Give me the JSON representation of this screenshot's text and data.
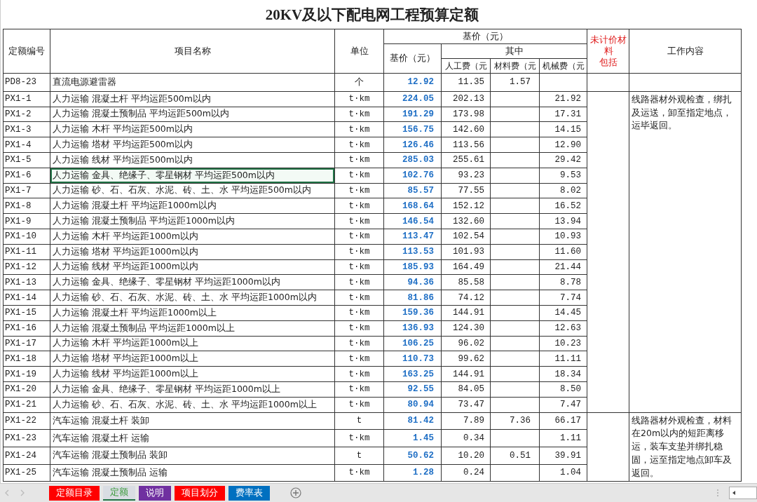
{
  "title": "20KV及以下配电网工程预算定额",
  "header": {
    "code": "定额编号",
    "name": "项目名称",
    "unit": "单位",
    "base_group": "基价（元）",
    "base": "基价（元）",
    "among": "其中",
    "labor": "人工费（元",
    "material": "材料费（元",
    "machine": "机械费（元",
    "unpriced": [
      "未计价材料",
      "包括"
    ],
    "work": "工作内容"
  },
  "groups": [
    {
      "rows": [
        {
          "code": "PD8-23",
          "name": "直流电源避雷器",
          "unit": "个",
          "base": "12.92",
          "labor": "11.35",
          "material": "1.57",
          "selected": false
        }
      ]
    },
    {
      "work_content": "线路器材外观检查，绑扎及运送，卸至指定地点，运毕返回。",
      "rows": [
        {
          "code": "PX1-1",
          "name": "人力运输 混凝土杆 平均运距500m以内",
          "unit": "t·km",
          "base": "224.05",
          "labor": "202.13",
          "machine": "21.92",
          "selected": false
        },
        {
          "code": "PX1-2",
          "name": "人力运输 混凝土预制品 平均运距500m以内",
          "unit": "t·km",
          "base": "191.29",
          "labor": "173.98",
          "machine": "17.31",
          "selected": false
        },
        {
          "code": "PX1-3",
          "name": "人力运输 木杆 平均运距500m以内",
          "unit": "t·km",
          "base": "156.75",
          "labor": "142.60",
          "machine": "14.15",
          "selected": false
        },
        {
          "code": "PX1-4",
          "name": "人力运输 塔材 平均运距500m以内",
          "unit": "t·km",
          "base": "126.46",
          "labor": "113.56",
          "machine": "12.90",
          "selected": false
        },
        {
          "code": "PX1-5",
          "name": "人力运输 线材 平均运距500m以内",
          "unit": "t·km",
          "base": "285.03",
          "labor": "255.61",
          "machine": "29.42",
          "selected": false
        },
        {
          "code": "PX1-6",
          "name": "人力运输 金具、绝缘子、零星钢材 平均运距500m以内",
          "unit": "t·km",
          "base": "102.76",
          "labor": "93.23",
          "machine": "9.53",
          "selected": true
        },
        {
          "code": "PX1-7",
          "name": "人力运输 砂、石、石灰、水泥、砖、土、水 平均运距500m以内",
          "unit": "t·km",
          "base": "85.57",
          "labor": "77.55",
          "machine": "8.02",
          "selected": false
        },
        {
          "code": "PX1-8",
          "name": "人力运输 混凝土杆 平均运距1000m以内",
          "unit": "t·km",
          "base": "168.64",
          "labor": "152.12",
          "machine": "16.52",
          "selected": false
        },
        {
          "code": "PX1-9",
          "name": "人力运输 混凝土预制品 平均运距1000m以内",
          "unit": "t·km",
          "base": "146.54",
          "labor": "132.60",
          "machine": "13.94",
          "selected": false
        },
        {
          "code": "PX1-10",
          "name": "人力运输 木杆 平均运距1000m以内",
          "unit": "t·km",
          "base": "113.47",
          "labor": "102.54",
          "machine": "10.93",
          "selected": false
        },
        {
          "code": "PX1-11",
          "name": "人力运输 塔材 平均运距1000m以内",
          "unit": "t·km",
          "base": "113.53",
          "labor": "101.93",
          "machine": "11.60",
          "selected": false
        },
        {
          "code": "PX1-12",
          "name": "人力运输 线材 平均运距1000m以内",
          "unit": "t·km",
          "base": "185.93",
          "labor": "164.49",
          "machine": "21.44",
          "selected": false
        },
        {
          "code": "PX1-13",
          "name": "人力运输 金具、绝缘子、零星钢材 平均运距1000m以内",
          "unit": "t·km",
          "base": "94.36",
          "labor": "85.58",
          "machine": "8.78",
          "selected": false
        },
        {
          "code": "PX1-14",
          "name": "人力运输 砂、石、石灰、水泥、砖、土、水 平均运距1000m以内",
          "unit": "t·km",
          "base": "81.86",
          "labor": "74.12",
          "machine": "7.74",
          "selected": false
        },
        {
          "code": "PX1-15",
          "name": "人力运输 混凝土杆 平均运距1000m以上",
          "unit": "t·km",
          "base": "159.36",
          "labor": "144.91",
          "machine": "14.45",
          "selected": false
        },
        {
          "code": "PX1-16",
          "name": "人力运输 混凝土预制品 平均运距1000m以上",
          "unit": "t·km",
          "base": "136.93",
          "labor": "124.30",
          "machine": "12.63",
          "selected": false
        },
        {
          "code": "PX1-17",
          "name": "人力运输 木杆 平均运距1000m以上",
          "unit": "t·km",
          "base": "106.25",
          "labor": "96.02",
          "machine": "10.23",
          "selected": false
        },
        {
          "code": "PX1-18",
          "name": "人力运输 塔材 平均运距1000m以上",
          "unit": "t·km",
          "base": "110.73",
          "labor": "99.62",
          "machine": "11.11",
          "selected": false
        },
        {
          "code": "PX1-19",
          "name": "人力运输 线材 平均运距1000m以上",
          "unit": "t·km",
          "base": "163.25",
          "labor": "144.91",
          "machine": "18.34",
          "selected": false
        },
        {
          "code": "PX1-20",
          "name": "人力运输 金具、绝缘子、零星钢材 平均运距1000m以上",
          "unit": "t·km",
          "base": "92.55",
          "labor": "84.05",
          "machine": "8.50",
          "selected": false
        },
        {
          "code": "PX1-21",
          "name": "人力运输 砂、石、石灰、水泥、砖、土、水 平均运距1000m以上",
          "unit": "t·km",
          "base": "80.94",
          "labor": "73.47",
          "machine": "7.47",
          "selected": false
        }
      ]
    },
    {
      "work_content": "线路器材外观检查，材料在20m以内的短距离移运，装车支垫并绑扎稳固，运至指定地点卸车及返回。",
      "rows": [
        {
          "code": "PX1-22",
          "name": "汽车运输 混凝土杆 装卸",
          "unit": "t",
          "base": "81.42",
          "labor": "7.89",
          "material": "7.36",
          "machine": "66.17",
          "selected": false
        },
        {
          "code": "PX1-23",
          "name": "汽车运输 混凝土杆 运输",
          "unit": "t·km",
          "base": "1.45",
          "labor": "0.34",
          "machine": "1.11",
          "selected": false
        },
        {
          "code": "PX1-24",
          "name": "汽车运输 混凝土预制品 装卸",
          "unit": "t",
          "base": "50.62",
          "labor": "10.20",
          "material": "0.51",
          "machine": "39.91",
          "selected": false
        },
        {
          "code": "PX1-25",
          "name": "汽车运输 混凝土预制品 运输",
          "unit": "t·km",
          "base": "1.28",
          "labor": "0.24",
          "machine": "1.04",
          "selected": false
        }
      ]
    }
  ],
  "sheet_tabs": [
    {
      "label": "定额目录",
      "color": "#ff0000",
      "selected": false
    },
    {
      "label": "定额",
      "color": "#d9dde3",
      "selected": true
    },
    {
      "label": "说明",
      "color": "#7030a0",
      "selected": false
    },
    {
      "label": "项目划分",
      "color": "#ff0000",
      "selected": false
    },
    {
      "label": "费率表",
      "color": "#0070c0",
      "selected": false
    }
  ]
}
